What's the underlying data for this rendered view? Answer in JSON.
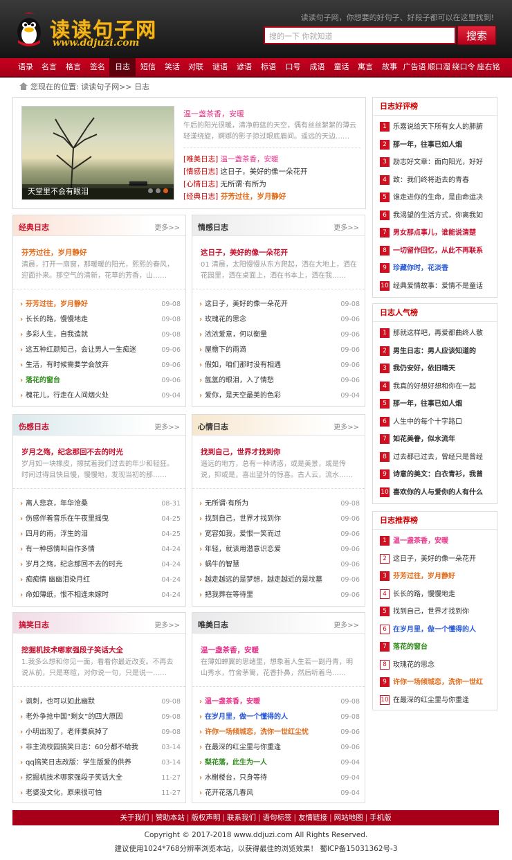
{
  "header": {
    "logo_title": "读读句子网",
    "logo_url": "www.ddjuzi.com",
    "slogan": "读读句子网，你想要的好句子、好段子都可以在这里找到!",
    "search_placeholder": "搜的一下 你就知道",
    "search_button": "搜索"
  },
  "nav": [
    "语录",
    "名言",
    "格言",
    "签名",
    "日志",
    "短信",
    "笑话",
    "对联",
    "谜语",
    "谚语",
    "标语",
    "口号",
    "成语",
    "童话",
    "寓言",
    "故事",
    "广告语",
    "顺口溜",
    "绕口令",
    "座右铭"
  ],
  "nav_current": "日志",
  "breadcrumb": "您现在的位置:  读读句子网>> 日志",
  "top": {
    "slide_caption": "天堂里不会有眼泪",
    "title": "温一盏茶香，安暖",
    "desc": "午后的阳光很暖，清净蔚蓝的天空，偶有丝丝絮絮的薄云轻漾绕旋，婀娜的影子掠过眼底眉间。遥远的天边……",
    "list": [
      {
        "cat": "[唯美日志]",
        "text": "温一盏茶香，安暖",
        "color": "#e9338a",
        "bold": false
      },
      {
        "cat": "[情感日志]",
        "text": "这日子，美好的像一朵花开",
        "color": "#333333",
        "bold": false
      },
      {
        "cat": "[心情日志]",
        "text": "无所谓·有所为",
        "color": "#333333",
        "bold": false
      },
      {
        "cat": "[经典日志]",
        "text": "芬芳过往，岁月静好",
        "color": "#e26b1a",
        "bold": true
      }
    ]
  },
  "sections": [
    {
      "title": "经典日志",
      "title_color": "#c8102e",
      "more": "更多>>",
      "feature_title": "芬芳过往，岁月静好",
      "feature_color": "#e26b1a",
      "feature_desc": "清晨，打开一扇窗，那暖暖的阳光，熙熙的春风，迎面扑来。那空气的清新，花草的芳香，山……",
      "items": [
        {
          "t": "芬芳过往，岁月静好",
          "d": "09-08",
          "c": "#e26b1a",
          "b": true
        },
        {
          "t": "长长的路，慢慢地走",
          "d": "09-08",
          "c": "#333333",
          "b": false
        },
        {
          "t": "多彩人生，自我造就",
          "d": "09-08",
          "c": "#333333",
          "b": false
        },
        {
          "t": "这五种红颜知己，会让男人一生痴迷",
          "d": "09-06",
          "c": "#333333",
          "b": false
        },
        {
          "t": "生活，有时候需要学会放弃",
          "d": "09-06",
          "c": "#333333",
          "b": false
        },
        {
          "t": "落花的窗台",
          "d": "09-06",
          "c": "#2e8b1a",
          "b": true
        },
        {
          "t": "槐花儿，行走在人间烟火处",
          "d": "09-04",
          "c": "#333333",
          "b": false
        }
      ]
    },
    {
      "title": "情感日志",
      "title_color": "#333333",
      "more": "更多>>",
      "feature_title": "这日子，美好的像一朵花开",
      "feature_color": "#c8102e",
      "feature_desc": "01 清晨，太阳慢慢从东方爬起，洒在大地上，洒在花园里，洒在桌面上，洒在书本上，洒在我……",
      "items": [
        {
          "t": "这日子，美好的像一朵花开",
          "d": "09-08",
          "c": "#333333",
          "b": false
        },
        {
          "t": "玫瑰花的思念",
          "d": "09-06",
          "c": "#333333",
          "b": false
        },
        {
          "t": "浓浓爱意，何以衡量",
          "d": "09-06",
          "c": "#333333",
          "b": false
        },
        {
          "t": "屋檐下的雨滴",
          "d": "09-06",
          "c": "#333333",
          "b": false
        },
        {
          "t": "假如，咱们那时没有相遇",
          "d": "09-06",
          "c": "#333333",
          "b": false
        },
        {
          "t": "氤氲的眼泪，入了情愁",
          "d": "09-06",
          "c": "#333333",
          "b": false
        },
        {
          "t": "爱你，是天空最美的色彩",
          "d": "09-04",
          "c": "#333333",
          "b": false
        }
      ]
    },
    {
      "title": "伤感日志",
      "title_color": "#c8102e",
      "more": "更多>>",
      "feature_title": "岁月之殇，纪念那回不去的时光",
      "feature_color": "#c8102e",
      "feature_desc": "岁月如一块橡皮，擦拭着我们过去的年少和轻狂。时间过得且快且慢，慢慢地，发现当初的那……",
      "items": [
        {
          "t": "离人悲哀，年华沧桑",
          "d": "08-31",
          "c": "#333333",
          "b": false
        },
        {
          "t": "伤感伴着音乐在午夜里摇曳",
          "d": "04-25",
          "c": "#333333",
          "b": false
        },
        {
          "t": "四月的雨，浮生的泪",
          "d": "04-25",
          "c": "#333333",
          "b": false
        },
        {
          "t": "有一种感情叫自作多情",
          "d": "04-24",
          "c": "#333333",
          "b": false
        },
        {
          "t": "岁月之殇，纪念那回不去的时光",
          "d": "04-24",
          "c": "#333333",
          "b": false
        },
        {
          "t": "痴痴情 幽幽泪染月红",
          "d": "04-24",
          "c": "#333333",
          "b": false
        },
        {
          "t": "命如薄纸，恨不相逢未嫁时",
          "d": "04-24",
          "c": "#333333",
          "b": false
        }
      ]
    },
    {
      "title": "心情日志",
      "title_color": "#333333",
      "more": "更多>>",
      "feature_title": "找到自己，世界才找到你",
      "feature_color": "#c8102e",
      "feature_desc": "遥远的地方，总有一种诱惑，或是美景，或是传说，抑或是，喜出望外的惊喜。古人云，流水……",
      "items": [
        {
          "t": "无所谓·有所为",
          "d": "09-08",
          "c": "#333333",
          "b": false
        },
        {
          "t": "找到自己，世界才找到你",
          "d": "09-06",
          "c": "#333333",
          "b": false
        },
        {
          "t": "宽容如我，爱恨一笑而过",
          "d": "09-06",
          "c": "#333333",
          "b": false
        },
        {
          "t": "年轻，就该用潜意识恋爱",
          "d": "09-06",
          "c": "#333333",
          "b": false
        },
        {
          "t": "蜗牛的智慧",
          "d": "09-06",
          "c": "#333333",
          "b": false
        },
        {
          "t": "越走越远的是梦想，越走越近的是坟墓",
          "d": "09-06",
          "c": "#333333",
          "b": false
        },
        {
          "t": "把我葬在等待里",
          "d": "09-06",
          "c": "#333333",
          "b": false
        }
      ]
    },
    {
      "title": "搞笑日志",
      "title_color": "#c8102e",
      "more": "更多>>",
      "feature_title": "挖掘机技术哪家强段子笑话大全",
      "feature_color": "#c8102e",
      "feature_desc": "1.我多么想和你见一面，看看你最近改变。不再去说从前，只是寒暄，对你说一句，只是说一……",
      "items": [
        {
          "t": "讽刺，也可以如此幽默",
          "d": "09-08",
          "c": "#333333",
          "b": false
        },
        {
          "t": "老外争抢中国“剩女”的四大原因",
          "d": "09-08",
          "c": "#333333",
          "b": false
        },
        {
          "t": "小明出现了，老师要疯掉了",
          "d": "09-08",
          "c": "#333333",
          "b": false
        },
        {
          "t": "非主流校园搞笑日志：60分都不给我",
          "d": "03-14",
          "c": "#333333",
          "b": false
        },
        {
          "t": "qq搞笑日志改版：学生版爱的供养",
          "d": "03-14",
          "c": "#333333",
          "b": false
        },
        {
          "t": "挖掘机技术哪家强段子笑话大全",
          "d": "11-27",
          "c": "#333333",
          "b": false
        },
        {
          "t": "老婆没文化，原来很可怕",
          "d": "11-27",
          "c": "#333333",
          "b": false
        }
      ]
    },
    {
      "title": "唯美日志",
      "title_color": "#333333",
      "more": "更多>>",
      "feature_title": "温一盏茶香，安暖",
      "feature_color": "#e9338a",
      "feature_desc": "在薄如蝉翼的思绪里，想象着人生若一副丹青，明山秀水，竹舍茅篱，花香扑鼻，然后听着鸟……",
      "items": [
        {
          "t": "温一盏茶香，安暖",
          "d": "09-08",
          "c": "#e9338a",
          "b": true
        },
        {
          "t": "在岁月里，做一个懂得的人",
          "d": "09-08",
          "c": "#2b5bd6",
          "b": true
        },
        {
          "t": "许你一场倾城恋，洗你一世红尘忧",
          "d": "09-06",
          "c": "#e26b1a",
          "b": true
        },
        {
          "t": "在最深的红尘里与你重逢",
          "d": "09-06",
          "c": "#333333",
          "b": false
        },
        {
          "t": "梨花落，此生为一人",
          "d": "09-04",
          "c": "#2e8b1a",
          "b": true
        },
        {
          "t": "水榭楼台，只身等待",
          "d": "09-04",
          "c": "#333333",
          "b": false
        },
        {
          "t": "花开花落几春风",
          "d": "09-04",
          "c": "#333333",
          "b": false
        }
      ]
    }
  ],
  "rank_boxes": [
    {
      "title": "日志好评榜",
      "items": [
        {
          "t": "乐嘉说给天下所有女人的肺腑",
          "c": "#333333",
          "b": false
        },
        {
          "t": "那一年，往事已如人烟",
          "c": "#333333",
          "b": true
        },
        {
          "t": "励志好文章：面向阳光，好好",
          "c": "#333333",
          "b": false
        },
        {
          "t": "致：我们终将逝去的青春",
          "c": "#333333",
          "b": false
        },
        {
          "t": "谁走进你的生命，是由命运决",
          "c": "#333333",
          "b": false
        },
        {
          "t": "我渴望的生活方式，你离我如",
          "c": "#333333",
          "b": false
        },
        {
          "t": "男女那点事儿，谁能说清楚",
          "c": "#c8102e",
          "b": true
        },
        {
          "t": "一切留作回忆，从此不再联系",
          "c": "#c8102e",
          "b": true
        },
        {
          "t": "珍藏你时，花淡香",
          "c": "#2b5bd6",
          "b": true
        },
        {
          "t": "经典爱情故事：爱情不是童话",
          "c": "#333333",
          "b": false
        }
      ]
    },
    {
      "title": "日志人气榜",
      "items": [
        {
          "t": "那就这样吧，再爱都曲终人散",
          "c": "#333333",
          "b": false
        },
        {
          "t": "男生日志：男人应该知道的",
          "c": "#333333",
          "b": true
        },
        {
          "t": "我仍安好，依旧晴天",
          "c": "#333333",
          "b": true
        },
        {
          "t": "我真的好想好想和你在一起",
          "c": "#333333",
          "b": false
        },
        {
          "t": "那一年，往事已如人烟",
          "c": "#333333",
          "b": true
        },
        {
          "t": "人生中的每个十字路口",
          "c": "#333333",
          "b": false
        },
        {
          "t": "如花美眷，似水流年",
          "c": "#333333",
          "b": true
        },
        {
          "t": "过去都已过去，曾经只是曾经",
          "c": "#333333",
          "b": false
        },
        {
          "t": "诗意的美文：白衣青衫，我曾",
          "c": "#333333",
          "b": true
        },
        {
          "t": "喜欢你的人与爱你的人有什么",
          "c": "#333333",
          "b": true
        }
      ]
    },
    {
      "title": "日志推荐榜",
      "items": [
        {
          "t": "温一盏茶香，安暖",
          "c": "#e9338a",
          "b": true
        },
        {
          "t": "这日子，美好的像一朵花开",
          "c": "#333333",
          "b": false
        },
        {
          "t": "芬芳过往，岁月静好",
          "c": "#e26b1a",
          "b": true
        },
        {
          "t": "长长的路，慢慢地走",
          "c": "#333333",
          "b": false
        },
        {
          "t": "找到自己，世界才找到你",
          "c": "#333333",
          "b": false
        },
        {
          "t": "在岁月里，做一个懂得的人",
          "c": "#2b5bd6",
          "b": true
        },
        {
          "t": "落花的窗台",
          "c": "#2e8b1a",
          "b": true
        },
        {
          "t": "玫瑰花的思念",
          "c": "#333333",
          "b": false
        },
        {
          "t": "许你一场倾城恋，洗你一世红",
          "c": "#e26b1a",
          "b": true
        },
        {
          "t": "在最深的红尘里与你重逢",
          "c": "#333333",
          "b": false
        }
      ]
    }
  ],
  "footer": {
    "links": [
      "关于我们",
      "赞助本站",
      "版权声明",
      "联系我们",
      "语句标签",
      "友情链接",
      "网站地图",
      "手机版"
    ],
    "copyright": "Copyright © 2017-2018 www.ddjuzi.com All Rights Reserved.",
    "notice": "建议使用1024*768分辨率浏览本站，以获得最佳的浏览效果！ 蜀ICP备15031362号-3"
  },
  "colors": {
    "brand_red": "#a80019",
    "logo_gold": "#f2b61c",
    "header_dark": "#1e1e1e"
  }
}
